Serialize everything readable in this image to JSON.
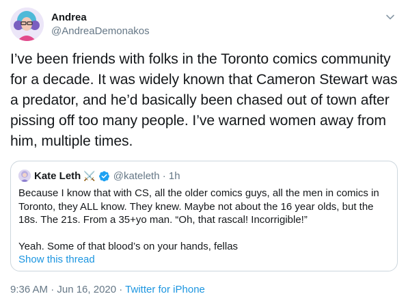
{
  "author": {
    "avatar_icon": "avatar-illustration",
    "name": "Andrea",
    "handle": "@AndreaDemonakos"
  },
  "menu_icon": "chevron-down-icon",
  "tweet": {
    "text": "I’ve been friends with folks in the Toronto comics community for a decade. It was widely known that Cameron Stewart was a predator, and he’d basically been chased out of town after pissing off too many people. I’ve warned women away from him, multiple times."
  },
  "quoted": {
    "avatar_icon": "avatar-illustration",
    "name": "Kate Leth",
    "name_emoji": "⚔️",
    "verified_icon": "verified-badge-icon",
    "handle_time": "@kateleth · 1h",
    "text": "Because I know that with CS, all the older comics guys, all the men in comics in Toronto, they ALL know. They knew. Maybe not about the 16 year olds, but the 18s. The 21s. From a 35+yo man. “Oh, that rascal! Incorrigible!”\n\nYeah. Some of that blood’s on your hands, fellas",
    "show_thread": "Show this thread"
  },
  "footer": {
    "timestamp": "9:36 AM · Jun 16, 2020 · ",
    "source": "Twitter for iPhone"
  },
  "colors": {
    "link": "#1b95e0",
    "secondary": "#657786",
    "border": "#ccd6dd",
    "verified": "#1da1f2"
  }
}
